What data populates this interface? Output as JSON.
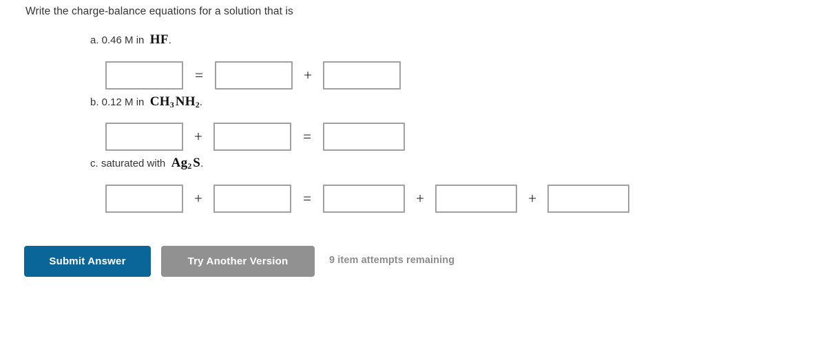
{
  "question": {
    "prompt": "Write the charge-balance equations for a solution that is"
  },
  "parts": [
    {
      "id": "a",
      "label_prefix": "a. 0.46 M in",
      "formula_parts": [
        {
          "text": "HF",
          "sub": ""
        }
      ],
      "formula_plain": "HF",
      "trailing_period": ".",
      "operators": [
        "=",
        "+"
      ],
      "boxes": [
        {
          "name": "part-a-box-1",
          "value": "",
          "placeholder": ""
        },
        {
          "name": "part-a-box-2",
          "value": "",
          "placeholder": ""
        },
        {
          "name": "part-a-box-3",
          "value": "",
          "placeholder": ""
        }
      ]
    },
    {
      "id": "b",
      "label_prefix": "b. 0.12 M in",
      "formula_parts": [
        {
          "text": "CH",
          "sub": "3"
        },
        {
          "text": "NH",
          "sub": "2"
        }
      ],
      "formula_plain": "CH3NH2",
      "trailing_period": ".",
      "operators": [
        "+",
        "="
      ],
      "boxes": [
        {
          "name": "part-b-box-1",
          "value": "",
          "placeholder": ""
        },
        {
          "name": "part-b-box-2",
          "value": "",
          "placeholder": ""
        },
        {
          "name": "part-b-box-3",
          "value": "",
          "placeholder": ""
        }
      ]
    },
    {
      "id": "c",
      "label_prefix": "c. saturated with",
      "formula_parts": [
        {
          "text": "Ag",
          "sub": "2"
        },
        {
          "text": "S",
          "sub": ""
        }
      ],
      "formula_plain": "Ag2S",
      "trailing_period": ".",
      "operators": [
        "+",
        "=",
        "+",
        "+"
      ],
      "boxes": [
        {
          "name": "part-c-box-1",
          "value": "",
          "placeholder": ""
        },
        {
          "name": "part-c-box-2",
          "value": "",
          "placeholder": ""
        },
        {
          "name": "part-c-box-3",
          "value": "",
          "placeholder": ""
        },
        {
          "name": "part-c-box-4",
          "value": "",
          "placeholder": ""
        },
        {
          "name": "part-c-box-5",
          "value": "",
          "placeholder": ""
        }
      ]
    }
  ],
  "actions": {
    "submit_label": "Submit Answer",
    "try_another_label": "Try Another Version",
    "attempts_text": "9 item attempts remaining"
  },
  "colors": {
    "submit_blue": "#0a6599",
    "try_another_gray": "#919191",
    "box_border": "#a0a0a0",
    "text": "#333333",
    "attempts_text": "#8c8c8c",
    "background": "#ffffff"
  }
}
